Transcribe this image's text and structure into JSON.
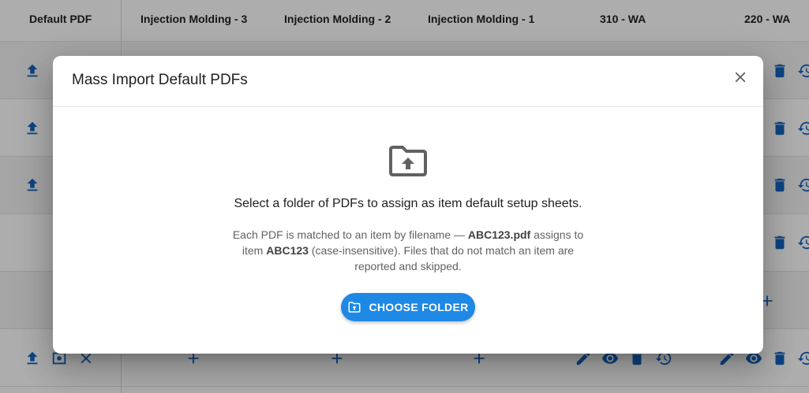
{
  "table": {
    "columns": [
      "Default PDF",
      "Injection Molding - 3",
      "Injection Molding - 2",
      "Injection Molding - 1",
      "310 - WA",
      "220 - WA"
    ]
  },
  "dialog": {
    "title": "Mass Import Default PDFs",
    "lead": "Select a folder of PDFs to assign as item default setup sheets.",
    "description": {
      "p1": "Each PDF is matched to an item by filename — ",
      "example_file": "ABC123.pdf",
      "p2": " assigns to item ",
      "example_item": "ABC123",
      "p3": " (case-insensitive). Files that do not match an item are reported and skipped."
    },
    "choose_label": "CHOOSE FOLDER"
  },
  "icons": {
    "upload": "upload-icon",
    "view": "view-pdf-icon",
    "clear": "clear-icon",
    "add": "add-icon",
    "edit": "edit-icon",
    "eye": "eye-icon",
    "delete": "delete-icon",
    "history": "history-icon",
    "close": "close-icon",
    "folder": "folder-upload-icon"
  },
  "colors": {
    "primary": "#1e88e5",
    "icon_blue": "#1565c0",
    "backdrop": "rgba(0,0,0,0.32)"
  }
}
